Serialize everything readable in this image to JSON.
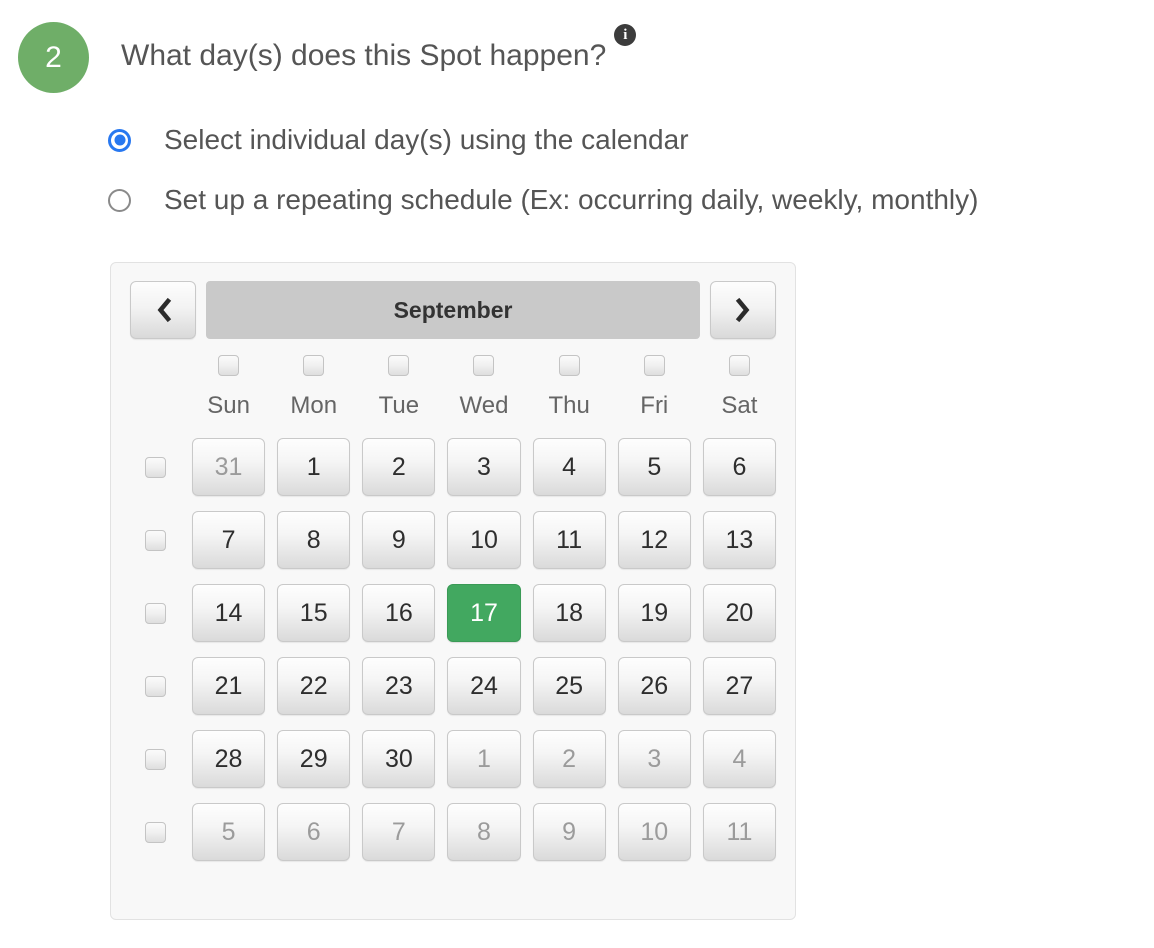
{
  "question": {
    "step_number": "2",
    "title": "What day(s) does this Spot happen?",
    "info_icon": "info-icon",
    "info_glyph": "i"
  },
  "options": [
    {
      "label": "Select individual day(s) using the calendar",
      "selected": true
    },
    {
      "label": "Set up a repeating schedule (Ex: occurring daily, weekly, monthly)",
      "selected": false
    }
  ],
  "calendar": {
    "prev_icon": "chevron-left-icon",
    "next_icon": "chevron-right-icon",
    "month": "September",
    "weekdays": [
      "Sun",
      "Mon",
      "Tue",
      "Wed",
      "Thu",
      "Fri",
      "Sat"
    ],
    "weeks": [
      {
        "days": [
          {
            "num": "31",
            "state": "other-month"
          },
          {
            "num": "1",
            "state": "current"
          },
          {
            "num": "2",
            "state": "current"
          },
          {
            "num": "3",
            "state": "current"
          },
          {
            "num": "4",
            "state": "current"
          },
          {
            "num": "5",
            "state": "current"
          },
          {
            "num": "6",
            "state": "current"
          }
        ]
      },
      {
        "days": [
          {
            "num": "7",
            "state": "current"
          },
          {
            "num": "8",
            "state": "current"
          },
          {
            "num": "9",
            "state": "current"
          },
          {
            "num": "10",
            "state": "current"
          },
          {
            "num": "11",
            "state": "current"
          },
          {
            "num": "12",
            "state": "current"
          },
          {
            "num": "13",
            "state": "current"
          }
        ]
      },
      {
        "days": [
          {
            "num": "14",
            "state": "current"
          },
          {
            "num": "15",
            "state": "current"
          },
          {
            "num": "16",
            "state": "current"
          },
          {
            "num": "17",
            "state": "selected"
          },
          {
            "num": "18",
            "state": "current"
          },
          {
            "num": "19",
            "state": "current"
          },
          {
            "num": "20",
            "state": "current"
          }
        ]
      },
      {
        "days": [
          {
            "num": "21",
            "state": "current"
          },
          {
            "num": "22",
            "state": "current"
          },
          {
            "num": "23",
            "state": "current"
          },
          {
            "num": "24",
            "state": "current"
          },
          {
            "num": "25",
            "state": "current"
          },
          {
            "num": "26",
            "state": "current"
          },
          {
            "num": "27",
            "state": "current"
          }
        ]
      },
      {
        "days": [
          {
            "num": "28",
            "state": "current"
          },
          {
            "num": "29",
            "state": "current"
          },
          {
            "num": "30",
            "state": "current"
          },
          {
            "num": "1",
            "state": "other-month"
          },
          {
            "num": "2",
            "state": "other-month"
          },
          {
            "num": "3",
            "state": "other-month"
          },
          {
            "num": "4",
            "state": "other-month"
          }
        ]
      },
      {
        "days": [
          {
            "num": "5",
            "state": "other-month"
          },
          {
            "num": "6",
            "state": "other-month"
          },
          {
            "num": "7",
            "state": "other-month"
          },
          {
            "num": "8",
            "state": "other-month"
          },
          {
            "num": "9",
            "state": "other-month"
          },
          {
            "num": "10",
            "state": "other-month"
          },
          {
            "num": "11",
            "state": "other-month"
          }
        ]
      }
    ],
    "column_checkboxes_checked": [
      false,
      false,
      false,
      false,
      false,
      false,
      false
    ],
    "row_checkboxes_checked": [
      false,
      false,
      false,
      false,
      false,
      false
    ]
  },
  "colors": {
    "step_badge_green": "#6fae68",
    "selected_day_green": "#42a860",
    "radio_blue": "#2878f0",
    "month_bar_gray": "#c9c9c9",
    "panel_bg": "#f8f8f8"
  }
}
